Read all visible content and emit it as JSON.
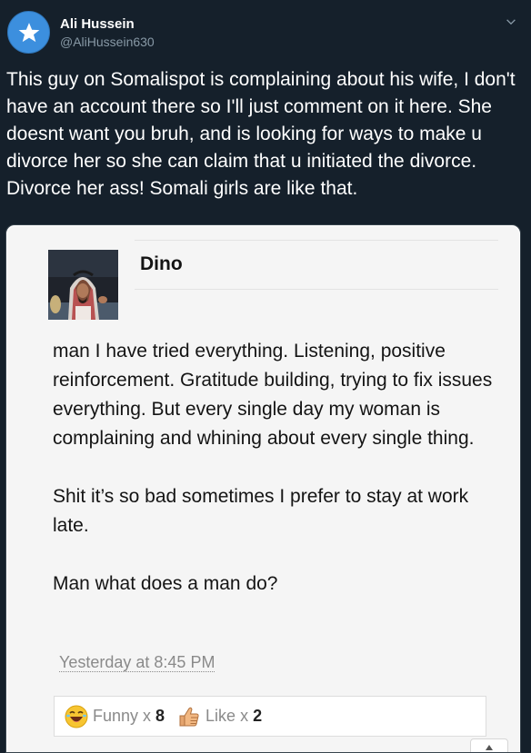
{
  "tweet": {
    "display_name": "Ali Hussein",
    "handle": "@AliHussein630",
    "text": "This guy on Somalispot is complaining about his wife, I don't have an account there so I'll just comment on it here. She doesnt want you bruh, and is looking for ways to make u divorce her so she can claim that u initiated the divorce. Divorce her ass! Somali girls are like that.",
    "avatar_icon": "star-icon",
    "menu_icon": "chevron-down-icon",
    "colors": {
      "background": "#15202b",
      "avatar": "#3c8fde",
      "handle": "#8899a6"
    }
  },
  "embedded_post": {
    "username": "Dino",
    "paragraphs": [
      "man I have tried everything. Listening, positive reinforcement. Gratitude building, trying to fix issues everything. But every single day my woman is complaining and whining about every single thing.",
      "Shit it’s so bad sometimes I prefer to stay at work late.",
      "Man what does a man do?"
    ],
    "timestamp": "Yesterday at 8:45 PM",
    "reactions": [
      {
        "icon": "laughing-emoji-icon",
        "label": "Funny x",
        "count": "8"
      },
      {
        "icon": "thumbs-up-icon",
        "label": "Like x",
        "count": "2"
      }
    ],
    "scroll_icon": "arrow-up-icon"
  }
}
